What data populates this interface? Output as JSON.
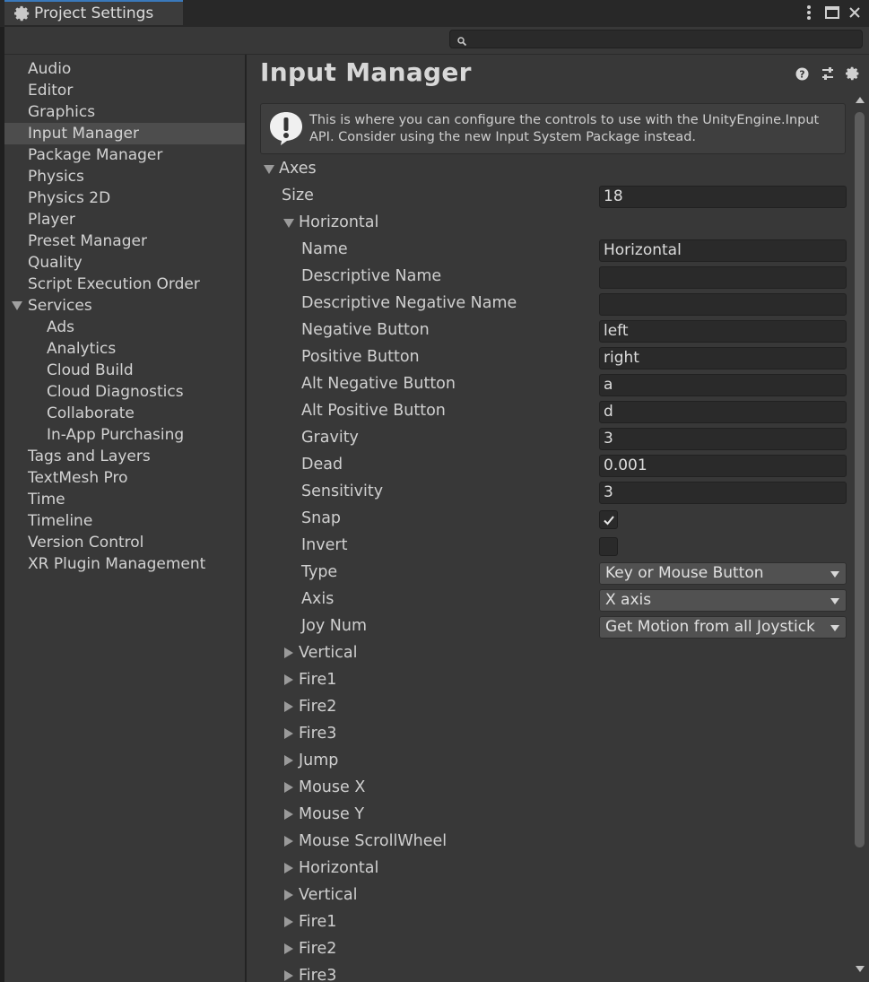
{
  "window": {
    "tab_title": "Project Settings",
    "search": {
      "placeholder": "",
      "value": ""
    }
  },
  "sidebar": {
    "items": [
      {
        "label": "Audio",
        "indent": 0
      },
      {
        "label": "Editor",
        "indent": 0
      },
      {
        "label": "Graphics",
        "indent": 0
      },
      {
        "label": "Input Manager",
        "indent": 0,
        "selected": true
      },
      {
        "label": "Package Manager",
        "indent": 0
      },
      {
        "label": "Physics",
        "indent": 0
      },
      {
        "label": "Physics 2D",
        "indent": 0
      },
      {
        "label": "Player",
        "indent": 0
      },
      {
        "label": "Preset Manager",
        "indent": 0
      },
      {
        "label": "Quality",
        "indent": 0
      },
      {
        "label": "Script Execution Order",
        "indent": 0
      },
      {
        "label": "Services",
        "indent": 0,
        "expanded": true
      },
      {
        "label": "Ads",
        "indent": 1
      },
      {
        "label": "Analytics",
        "indent": 1
      },
      {
        "label": "Cloud Build",
        "indent": 1
      },
      {
        "label": "Cloud Diagnostics",
        "indent": 1
      },
      {
        "label": "Collaborate",
        "indent": 1
      },
      {
        "label": "In-App Purchasing",
        "indent": 1
      },
      {
        "label": "Tags and Layers",
        "indent": 0
      },
      {
        "label": "TextMesh Pro",
        "indent": 0
      },
      {
        "label": "Time",
        "indent": 0
      },
      {
        "label": "Timeline",
        "indent": 0
      },
      {
        "label": "Version Control",
        "indent": 0
      },
      {
        "label": "XR Plugin Management",
        "indent": 0
      }
    ]
  },
  "main": {
    "title": "Input Manager",
    "help_message": "This is where you can configure the controls to use with the UnityEngine.Input API. Consider using the new Input System Package instead.",
    "axes_label": "Axes",
    "size_label": "Size",
    "size_value": "18",
    "expanded_axis": "Horizontal",
    "fields": [
      {
        "label": "Name",
        "value": "Horizontal",
        "kind": "text"
      },
      {
        "label": "Descriptive Name",
        "value": "",
        "kind": "text"
      },
      {
        "label": "Descriptive Negative Name",
        "value": "",
        "kind": "text"
      },
      {
        "label": "Negative Button",
        "value": "left",
        "kind": "text"
      },
      {
        "label": "Positive Button",
        "value": "right",
        "kind": "text"
      },
      {
        "label": "Alt Negative Button",
        "value": "a",
        "kind": "text"
      },
      {
        "label": "Alt Positive Button",
        "value": "d",
        "kind": "text"
      },
      {
        "label": "Gravity",
        "value": "3",
        "kind": "text"
      },
      {
        "label": "Dead",
        "value": "0.001",
        "kind": "text"
      },
      {
        "label": "Sensitivity",
        "value": "3",
        "kind": "text"
      },
      {
        "label": "Snap",
        "value": true,
        "kind": "check"
      },
      {
        "label": "Invert",
        "value": false,
        "kind": "check"
      },
      {
        "label": "Type",
        "value": "Key or Mouse Button",
        "kind": "dropdown"
      },
      {
        "label": "Axis",
        "value": "X axis",
        "kind": "dropdown"
      },
      {
        "label": "Joy Num",
        "value": "Get Motion from all Joystick",
        "kind": "dropdown"
      }
    ],
    "collapsed_axes": [
      "Vertical",
      "Fire1",
      "Fire2",
      "Fire3",
      "Jump",
      "Mouse X",
      "Mouse Y",
      "Mouse ScrollWheel",
      "Horizontal",
      "Vertical",
      "Fire1",
      "Fire2",
      "Fire3"
    ]
  }
}
